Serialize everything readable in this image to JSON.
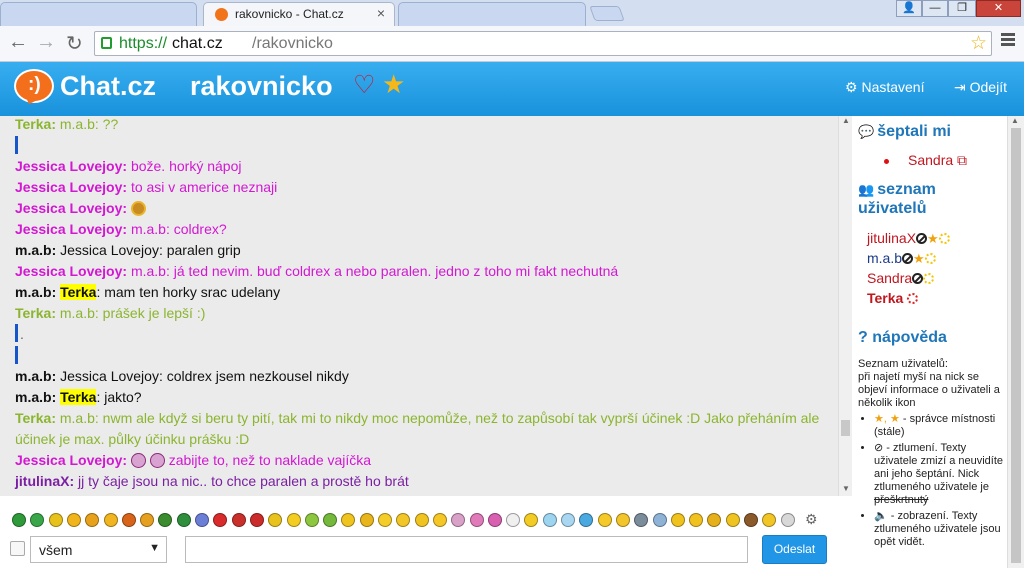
{
  "browser": {
    "tabs": [
      {
        "title": ""
      },
      {
        "title": "rakovnicko - Chat.cz",
        "close": "×"
      },
      {
        "title": ""
      }
    ],
    "window_buttons": {
      "profile": "👤",
      "minimize": "—",
      "restore": "❐",
      "close": "✕"
    },
    "nav": {
      "back": "←",
      "forward": "→",
      "reload": "↻"
    },
    "url": {
      "scheme": "https://",
      "host": "chat.cz",
      "path": "/rakovnicko"
    },
    "bookmark_star": "☆"
  },
  "header": {
    "logo_face": ":)",
    "site_name": "Chat.cz",
    "room": "rakovnicko",
    "heart": "♡",
    "star": "★",
    "settings_icon": "⚙",
    "settings_label": "Nastavení",
    "logout_icon": "⇥",
    "logout_label": "Odejít"
  },
  "messages": [
    {
      "nick": "Terka:",
      "text": " m.a.b: ??",
      "color": "#8bb52f"
    },
    {
      "nick": "Jessica Lovejoy:",
      "text": " bože. horký nápoj",
      "color": "#d317d3"
    },
    {
      "nick": "Jessica Lovejoy:",
      "text": " to asi v americe neznaji",
      "color": "#d317d3"
    },
    {
      "nick": "Jessica Lovejoy:",
      "text": " ",
      "color": "#d317d3"
    },
    {
      "nick": "Jessica Lovejoy:",
      "text": " m.a.b: coldrex?",
      "color": "#d317d3"
    },
    {
      "nick": "m.a.b:",
      "text": " Jessica Lovejoy: paralen grip",
      "color": "#111111"
    },
    {
      "nick": "Jessica Lovejoy:",
      "text": " m.a.b: já ted nevim. buď coldrex a nebo paralen. jedno z toho mi fakt nechutná",
      "color": "#d317d3"
    },
    {
      "nick": "m.a.b:",
      "mention": "Terka",
      "text": ": mam ten horky srac udelany",
      "color": "#111111"
    },
    {
      "nick": "Terka:",
      "text": " m.a.b: prášek je lepší :)",
      "color": "#8bb52f"
    },
    {
      "dot": "."
    },
    {
      "nick": "m.a.b:",
      "text": " Jessica Lovejoy: coldrex jsem nezkousel nikdy",
      "color": "#111111"
    },
    {
      "nick": "m.a.b:",
      "mention": "Terka",
      "text": ": jakto?",
      "color": "#111111"
    },
    {
      "nick": "Terka:",
      "text": " m.a.b: nwm ale když si beru ty pití, tak mi to nikdy moc nepomůže, než to zapůsobí tak vyprší účinek :D Jako přeháním ale",
      "text2": "účinek je max. půlky účinku prášku :D",
      "color": "#8bb52f"
    },
    {
      "nick": "Jessica Lovejoy:",
      "text": " zabijte to, než to naklade vajíčka",
      "color": "#d317d3"
    },
    {
      "nick": "jitulinaX:",
      "text": " jj ty čaje jsou na nic.. to chce paralen a prostě ho brát",
      "color": "#7a1fa2"
    }
  ],
  "sidebar": {
    "whisper_icon": "💬",
    "whisper_title": "šeptali mi",
    "whisper_user": "Sandra",
    "whisper_link_icon": "⧉",
    "users_icon": "👥",
    "users_title_1": "seznam",
    "users_title_2": "uživatelů",
    "users": [
      {
        "name": "jitulinaX",
        "color": "#c0171f"
      },
      {
        "name": "m.a.b",
        "color": "#1b3a8a"
      },
      {
        "name": "Sandra",
        "color": "#c0171f"
      },
      {
        "name": "Terka",
        "color": "#c0171f"
      }
    ],
    "help_icon": "?",
    "help_title": "nápověda",
    "help_intro_1": "Seznam uživatelů:",
    "help_intro_2": "při najetí myší na nick se objeví informace o uživateli a několik ikon",
    "help_items": [
      {
        "icons": "★, ★",
        "text": " - správce místnosti (stále)"
      },
      {
        "icons": "⊘",
        "text": " - ztlumení. Texty uživatele zmizí a neuvidíte ani jeho šeptání. Nick ztlumeného uživatele je ",
        "strike": "přeškrtnutý"
      },
      {
        "icons": "🔈",
        "text": " - zobrazení. Texty ztlumeného uživatele jsou opět vidět."
      }
    ]
  },
  "input": {
    "recipient": "všem",
    "caret": "▼",
    "send_label": "Odeslat",
    "gear": "⚙",
    "emoji_colors": [
      "#2e9a3a",
      "#3aa64a",
      "#e8c21a",
      "#f1b51b",
      "#e8a11a",
      "#f0b520",
      "#d8641a",
      "#e6a020",
      "#3b8c2f",
      "#2f8f3d",
      "#6c7fd6",
      "#d92b2b",
      "#c9302c",
      "#cc2b2b",
      "#e9c21c",
      "#f3cd21",
      "#8dc63f",
      "#74b83c",
      "#f0c41e",
      "#e8b51b",
      "#f5cd2a",
      "#f3c628",
      "#f0c420",
      "#f4c726",
      "#d9a0c8",
      "#e07ab8",
      "#d95fb0",
      "#f0f0f0",
      "#f2cc24",
      "#9dd5f0",
      "#a9d7f2",
      "#4aa9e0",
      "#f4c928",
      "#f2c52a",
      "#7b8c9a",
      "#8fb3d6",
      "#f0c21e",
      "#f1c21f",
      "#e6b01a",
      "#f0c420",
      "#8a5a2b",
      "#f2c526",
      "#d8d8d8"
    ]
  }
}
